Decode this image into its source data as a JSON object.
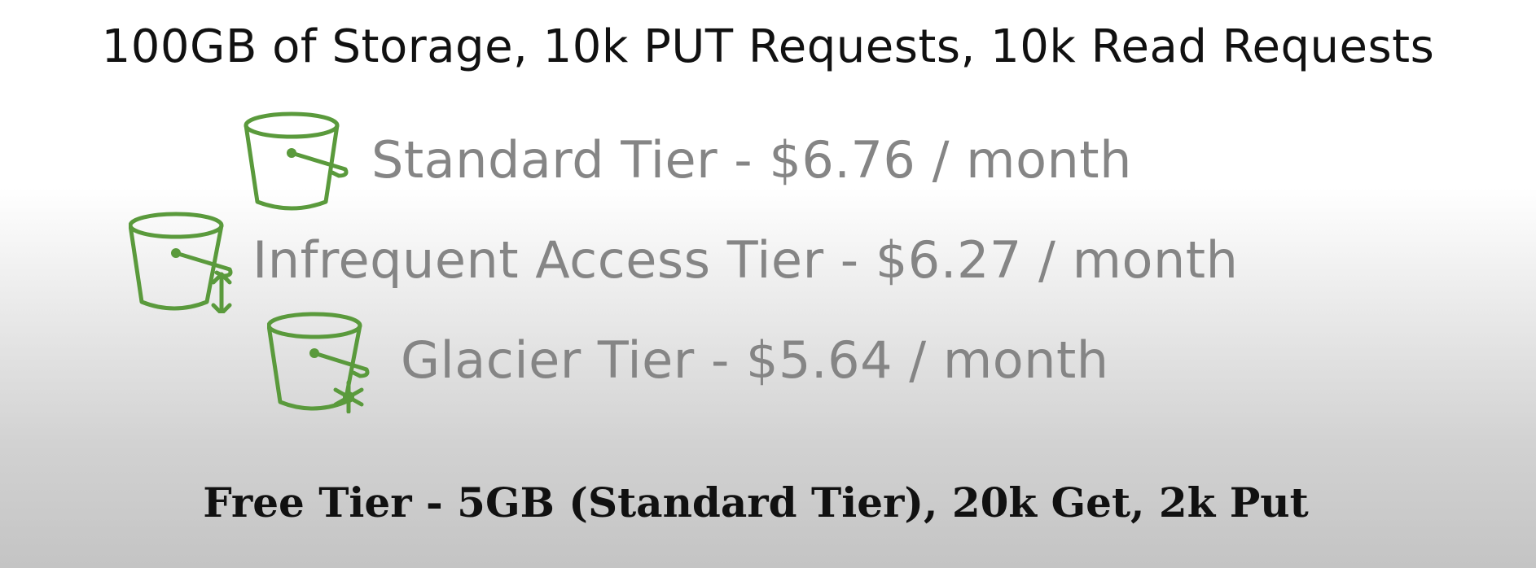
{
  "title": "100GB of Storage, 10k PUT Requests, 10k Read Requests",
  "tiers": [
    {
      "label": "Standard Tier - $6.76 / month",
      "icon": "bucket-icon"
    },
    {
      "label": "Infrequent Access Tier - $6.27 / month",
      "icon": "bucket-arrow-icon"
    },
    {
      "label": "Glacier Tier - $5.64 / month",
      "icon": "bucket-snowflake-icon"
    }
  ],
  "footer": "Free Tier - 5GB (Standard Tier), 20k Get, 2k Put",
  "colors": {
    "icon_green": "#5a9a3c",
    "tier_text": "#858585",
    "title_text": "#111111"
  }
}
